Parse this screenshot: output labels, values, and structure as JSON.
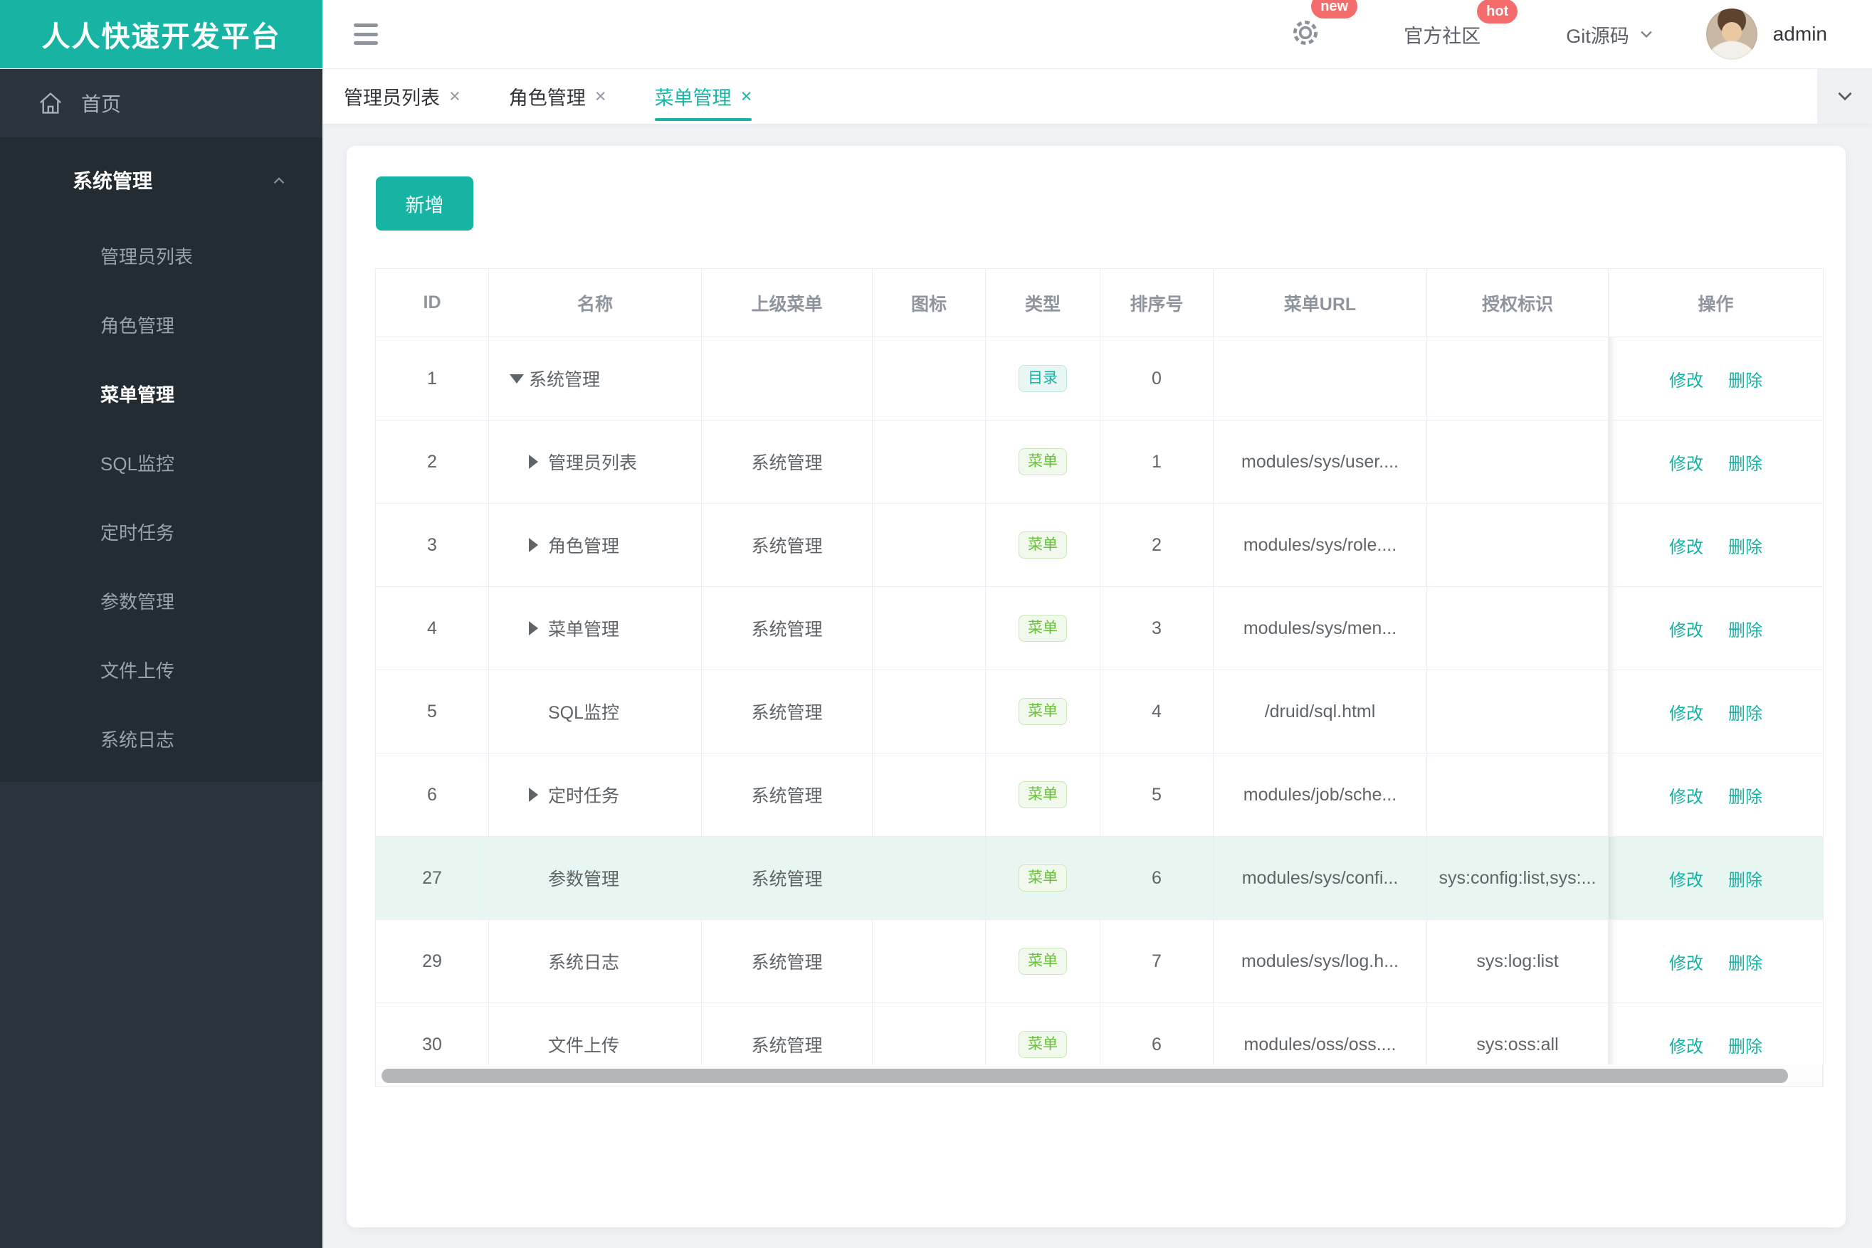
{
  "app": {
    "title": "人人快速开发平台"
  },
  "colors": {
    "brand": "#17B3A3",
    "badge_red": "#F56C6C",
    "tag_directory_green": "#17B3A3",
    "tag_menu_green": "#67C23A",
    "row_highlight": "#E8F6F2",
    "sidebar_bg": "#2A343C",
    "sidebar_section_bg": "#222C32"
  },
  "header": {
    "settings_badge": "new",
    "community_label": "官方社区",
    "community_badge": "hot",
    "git_label": "Git源码",
    "username": "admin"
  },
  "sidebar": {
    "home_label": "首页",
    "section": {
      "label": "系统管理",
      "expanded": true,
      "items": [
        {
          "label": "管理员列表",
          "active": false
        },
        {
          "label": "角色管理",
          "active": false
        },
        {
          "label": "菜单管理",
          "active": true
        },
        {
          "label": "SQL监控",
          "active": false
        },
        {
          "label": "定时任务",
          "active": false
        },
        {
          "label": "参数管理",
          "active": false
        },
        {
          "label": "文件上传",
          "active": false
        },
        {
          "label": "系统日志",
          "active": false
        }
      ]
    }
  },
  "tabs": {
    "close_glyph": "×",
    "items": [
      {
        "label": "管理员列表",
        "active": false
      },
      {
        "label": "角色管理",
        "active": false
      },
      {
        "label": "菜单管理",
        "active": true
      }
    ]
  },
  "toolbar": {
    "add_label": "新增"
  },
  "table": {
    "columns": [
      "ID",
      "名称",
      "上级菜单",
      "图标",
      "类型",
      "排序号",
      "菜单URL",
      "授权标识",
      "操作"
    ],
    "actions": {
      "edit": "修改",
      "delete": "删除"
    },
    "rows": [
      {
        "id": "1",
        "name": "系统管理",
        "arrow": "expanded",
        "level": 0,
        "parent": "",
        "icon": "",
        "type": "目录",
        "type_variant": "directory",
        "order": "0",
        "url": "",
        "auth": "",
        "highlighted": false
      },
      {
        "id": "2",
        "name": "管理员列表",
        "arrow": "collapsed",
        "level": 1,
        "parent": "系统管理",
        "icon": "",
        "type": "菜单",
        "type_variant": "menu",
        "order": "1",
        "url": "modules/sys/user....",
        "auth": "",
        "highlighted": false
      },
      {
        "id": "3",
        "name": "角色管理",
        "arrow": "collapsed",
        "level": 1,
        "parent": "系统管理",
        "icon": "",
        "type": "菜单",
        "type_variant": "menu",
        "order": "2",
        "url": "modules/sys/role....",
        "auth": "",
        "highlighted": false
      },
      {
        "id": "4",
        "name": "菜单管理",
        "arrow": "collapsed",
        "level": 1,
        "parent": "系统管理",
        "icon": "",
        "type": "菜单",
        "type_variant": "menu",
        "order": "3",
        "url": "modules/sys/men...",
        "auth": "",
        "highlighted": false
      },
      {
        "id": "5",
        "name": "SQL监控",
        "arrow": "none",
        "level": 1,
        "parent": "系统管理",
        "icon": "",
        "type": "菜单",
        "type_variant": "menu",
        "order": "4",
        "url": "/druid/sql.html",
        "auth": "",
        "highlighted": false
      },
      {
        "id": "6",
        "name": "定时任务",
        "arrow": "collapsed",
        "level": 1,
        "parent": "系统管理",
        "icon": "",
        "type": "菜单",
        "type_variant": "menu",
        "order": "5",
        "url": "modules/job/sche...",
        "auth": "",
        "highlighted": false
      },
      {
        "id": "27",
        "name": "参数管理",
        "arrow": "none",
        "level": 1,
        "parent": "系统管理",
        "icon": "",
        "type": "菜单",
        "type_variant": "menu",
        "order": "6",
        "url": "modules/sys/confi...",
        "auth": "sys:config:list,sys:...",
        "highlighted": true
      },
      {
        "id": "29",
        "name": "系统日志",
        "arrow": "none",
        "level": 1,
        "parent": "系统管理",
        "icon": "",
        "type": "菜单",
        "type_variant": "menu",
        "order": "7",
        "url": "modules/sys/log.h...",
        "auth": "sys:log:list",
        "highlighted": false
      },
      {
        "id": "30",
        "name": "文件上传",
        "arrow": "none",
        "level": 1,
        "parent": "系统管理",
        "icon": "",
        "type": "菜单",
        "type_variant": "menu",
        "order": "6",
        "url": "modules/oss/oss....",
        "auth": "sys:oss:all",
        "highlighted": false
      }
    ]
  }
}
